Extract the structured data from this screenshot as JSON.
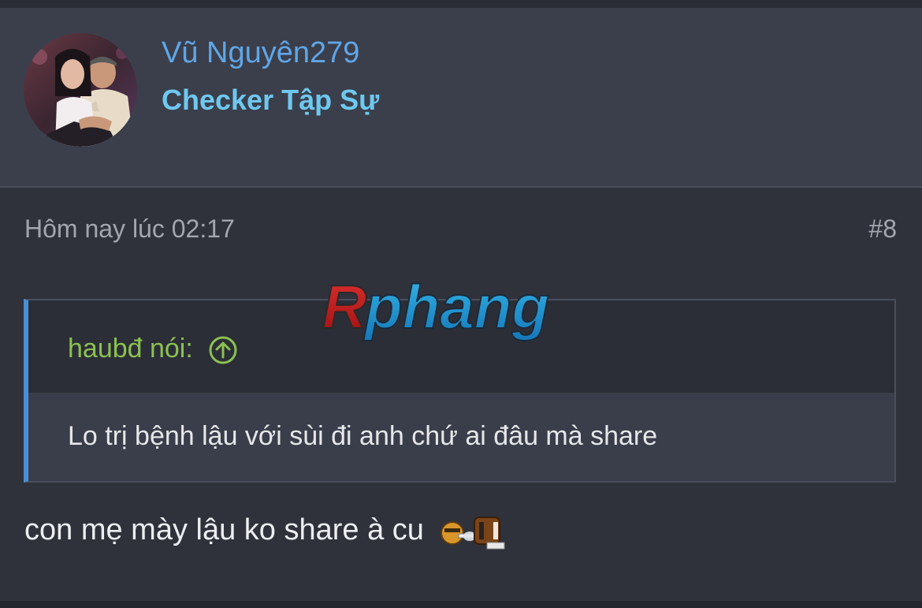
{
  "user": {
    "username": "Vũ Nguyên279",
    "title": "Checker Tập Sự"
  },
  "post": {
    "date": "Hôm nay lúc 02:17",
    "number": "#8"
  },
  "watermark": {
    "brand": "Rphang"
  },
  "quote": {
    "author": "haubđ nói:",
    "text": "Lo trị bệnh lậu với sùi đi anh chứ ai đâu mà share"
  },
  "message": {
    "text": "con mẹ mày lậu ko share à cu"
  },
  "icons": {
    "jump": "arrow-up-circle-icon",
    "emoji": "smoking-emoji-icon"
  },
  "colors": {
    "username": "#5fa6e8",
    "user_title": "#6ec8f0",
    "quote_author": "#8cc152",
    "quote_border": "#4a8fd6"
  }
}
